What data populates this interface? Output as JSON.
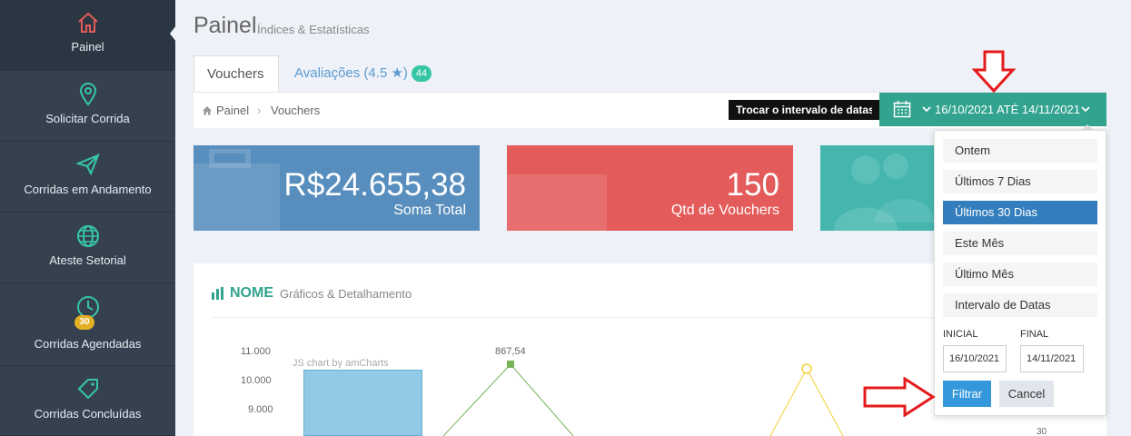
{
  "sidebar": {
    "items": [
      {
        "label": "Painel",
        "icon": "home-icon"
      },
      {
        "label": "Solicitar Corrida",
        "icon": "map-pin-icon"
      },
      {
        "label": "Corridas em Andamento",
        "icon": "send-icon"
      },
      {
        "label": "Ateste Setorial",
        "icon": "globe-icon"
      },
      {
        "label": "Corridas Agendadas",
        "icon": "clock-icon",
        "badge": "30"
      },
      {
        "label": "Corridas Concluídas",
        "icon": "tag-icon"
      }
    ]
  },
  "header": {
    "title": "Painel",
    "subtitle": "Índices & Estatísticas"
  },
  "tabs": [
    {
      "label": "Vouchers"
    },
    {
      "label": "Avaliações (4.5 ★)",
      "badge": "44"
    }
  ],
  "breadcrumb": [
    "Painel",
    "Vouchers"
  ],
  "daterange": {
    "tooltip": "Trocar o intervalo de datas",
    "label": "16/10/2021 ATÉ 14/11/2021"
  },
  "cards": [
    {
      "value": "R$24.655,38",
      "desc": "Soma Total",
      "color": "#578ebe"
    },
    {
      "value": "150",
      "desc": "Qtd de Vouchers",
      "color": "#e35b5a"
    },
    {
      "value": "",
      "desc": "",
      "color": "#44b6ae"
    }
  ],
  "panel": {
    "title": "NOME",
    "subtitle": "Gráficos & Detalhamento"
  },
  "chart": {
    "watermark": "JS chart by amCharts",
    "yticks": [
      "11.000",
      "10.000",
      "9.000"
    ],
    "point_label": "867,54",
    "right_label": "30"
  },
  "dropdown": {
    "ranges": [
      "Ontem",
      "Últimos 7 Dias",
      "Últimos 30 Dias",
      "Este Mês",
      "Último Mês",
      "Intervalo de Datas"
    ],
    "selected_index": 2,
    "initial_label": "INICIAL",
    "final_label": "FINAL",
    "initial_value": "16/10/2021",
    "final_value": "14/11/2021",
    "filter_label": "Filtrar",
    "cancel_label": "Cancel"
  }
}
